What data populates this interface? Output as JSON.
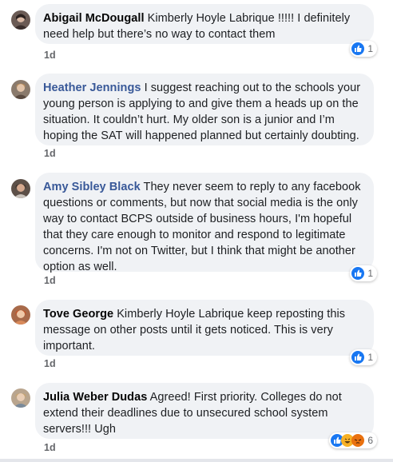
{
  "comments": [
    {
      "author": "Abigail McDougall",
      "text": "Kimberly Hoyle Labrique !!!!! I definitely need help but there’s no way to contact them",
      "time": "1d",
      "reaction_count": "1"
    },
    {
      "author": "Heather Jennings",
      "text": "I suggest reaching out to the schools your young person is applying to and give them a heads up on the situation. It couldn’t hurt. My older son is a junior and I’m hoping the SAT will happened planned but certainly doubting.",
      "time": "1d"
    },
    {
      "author": "Amy Sibley Black",
      "text": "They never seem to reply to any facebook questions or comments, but now that social media is the only way to contact BCPS outside of business hours, I'm hopeful that they care enough to monitor and respond to legitimate concerns. I'm not on Twitter, but I think that might be another option as well.",
      "time": "1d",
      "reaction_count": "1"
    },
    {
      "author": "Tove George",
      "text": "Kimberly Hoyle Labrique keep reposting this message on other posts until it gets noticed. This is very important.",
      "time": "1d",
      "reaction_count": "1"
    },
    {
      "author": "Julia Weber Dudas",
      "text": "Agreed! First priority. Colleges do not extend their deadlines due to unsecured school system servers!!! Ugh",
      "time": "1d",
      "reaction_count": "6"
    }
  ],
  "icons": {
    "like": "like-icon",
    "haha": "haha-icon",
    "angry": "angry-icon"
  },
  "colors": {
    "bubble": "#f0f2f5",
    "link_author": "#385898",
    "like_blue": "#1877f2",
    "timestamp": "#65676b"
  }
}
